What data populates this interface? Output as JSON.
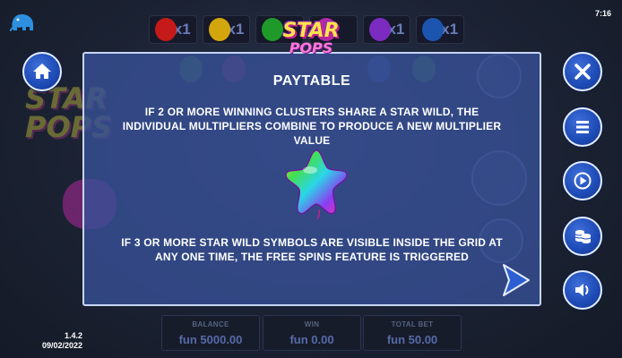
{
  "clock": "7:16",
  "version": "1.4.2",
  "date": "09/02/2022",
  "logo": {
    "top": "STAR",
    "bottom": "POPS"
  },
  "multipliers": [
    {
      "label": "x1",
      "color": "#c41a1a"
    },
    {
      "label": "x1",
      "color": "#d4a60d"
    },
    {
      "label": "",
      "color": "#1f9a2a"
    },
    {
      "label": "",
      "color": "#b02aa8"
    },
    {
      "label": "x1",
      "color": "#7b2bbf"
    },
    {
      "label": "x1",
      "color": "#1c55b0"
    }
  ],
  "panel": {
    "title": "PAYTABLE",
    "text_1": "IF 2 OR MORE WINNING CLUSTERS SHARE A STAR WILD, THE INDIVIDUAL MULTIPLIERS COMBINE TO PRODUCE A NEW MULTIPLIER VALUE",
    "text_2": "IF 3 OR MORE STAR WILD SYMBOLS ARE VISIBLE INSIDE THE GRID AT ANY ONE TIME, THE FREE SPINS FEATURE IS TRIGGERED",
    "symbol_icon": "rainbow-star-wild-icon",
    "next_icon": "next-arrow-icon"
  },
  "buttons": {
    "home": "home-icon",
    "close": "close-icon",
    "menu": "menu-icon",
    "autoplay": "autoplay-icon",
    "bet": "coins-icon",
    "sound": "sound-icon"
  },
  "footer": {
    "balance_label": "BALANCE",
    "balance_value": "fun 5000.00",
    "win_label": "WIN",
    "win_value": "fun 0.00",
    "bet_label": "TOTAL BET",
    "bet_value": "fun 50.00"
  },
  "colors": {
    "panel_bg": "#37509a",
    "button_blue": "#1d4ab5",
    "logo_yellow": "#ffe34a",
    "logo_pink": "#ff7ad6"
  }
}
